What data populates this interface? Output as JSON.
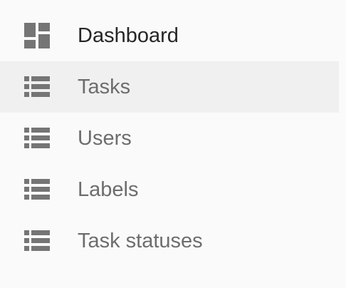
{
  "sidebar": {
    "items": [
      {
        "label": "Dashboard",
        "icon": "dashboard-icon",
        "active": false
      },
      {
        "label": "Tasks",
        "icon": "list-icon",
        "active": true
      },
      {
        "label": "Users",
        "icon": "list-icon",
        "active": false
      },
      {
        "label": "Labels",
        "icon": "list-icon",
        "active": false
      },
      {
        "label": "Task statuses",
        "icon": "list-icon",
        "active": false
      }
    ]
  },
  "colors": {
    "background": "#fafafa",
    "active_background": "#f0f0f0",
    "icon": "#757575",
    "label_text": "#6d6d6d",
    "primary_text": "#262626"
  }
}
